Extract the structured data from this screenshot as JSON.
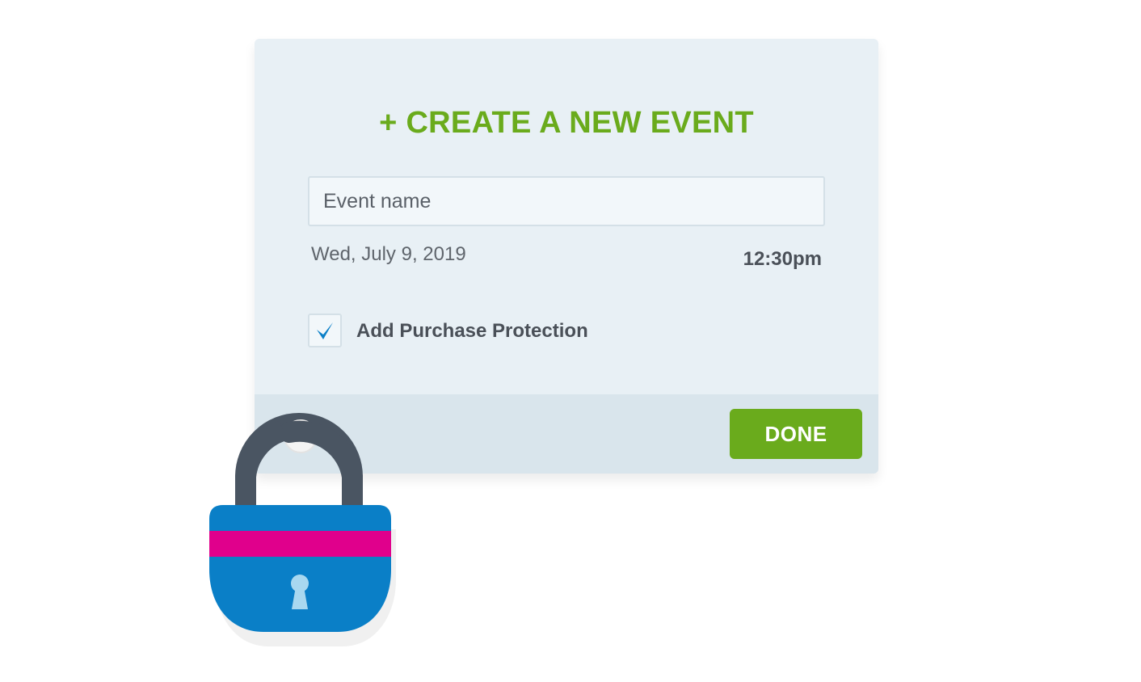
{
  "dialog": {
    "title": "+ CREATE A NEW EVENT",
    "event_name_placeholder": "Event name",
    "date": "Wed, July 9, 2019",
    "time": "12:30pm",
    "purchase_protection": {
      "label": "Add Purchase Protection",
      "checked": true
    },
    "done_label": "DONE"
  },
  "illustration": {
    "icon": "padlock-icon"
  },
  "colors": {
    "accent_green": "#6aab1c",
    "card_background": "#e8f0f5",
    "footer_background": "#d9e5ec",
    "check_blue": "#0a7fc7",
    "lock_blue": "#0a7fc7",
    "lock_stripe": "#e0008c",
    "lock_shackle": "#4a5562"
  }
}
